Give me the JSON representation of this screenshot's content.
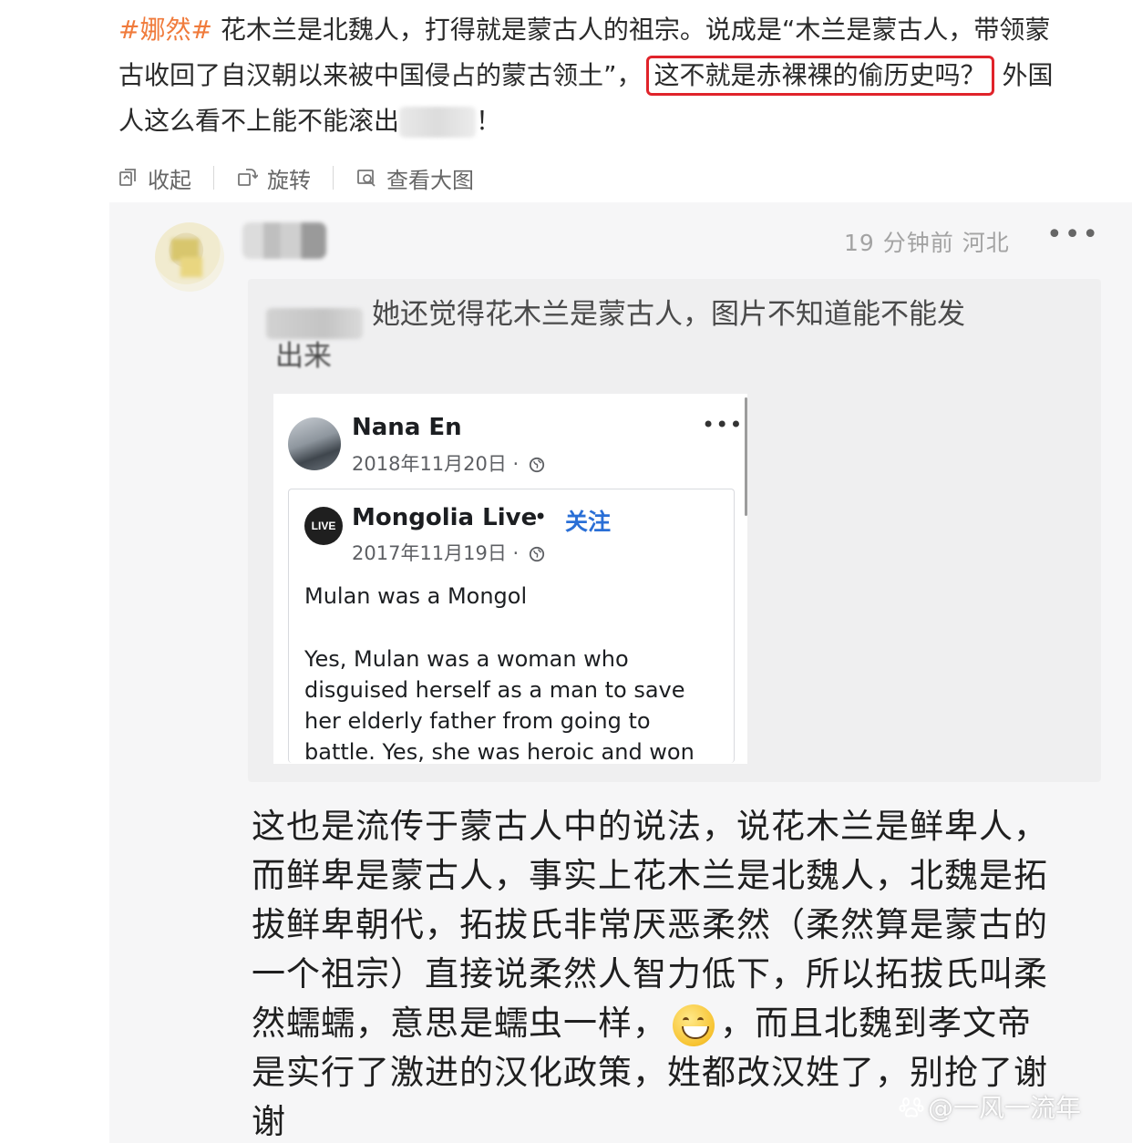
{
  "post": {
    "hashtag": "#娜然#",
    "line1_text": "花木兰是北魏人，打得就是蒙古人的祖宗。说成是“木兰是蒙古人，带领蒙",
    "line2_before": "古收回了自汉朝以来被中国侵占的蒙古领土”，",
    "line2_highlight": "这不就是赤裸裸的偷历史吗？",
    "line2_after": "外国",
    "line3_before": "人这么看不上能不能滚出",
    "line3_after": "！"
  },
  "toolbar": {
    "collapse_label": "收起",
    "rotate_label": "旋转",
    "view_large_label": "查看大图"
  },
  "comment": {
    "time_ago": "19 分钟前",
    "location": "河北",
    "more": "•••",
    "quote_line1": "她还觉得花木兰是蒙古人，图片不知道能不能发",
    "quote_line2": "出来",
    "text_lines": [
      "这也是流传于蒙古人中的说法，说花木兰是鲜卑人，",
      "而鲜卑是蒙古人，事实上花木兰是北魏人，北魏是拓",
      "拔鲜卑朝代，拓拔氏非常厌恶柔然（柔然算是蒙古的",
      "一个祖宗）直接说柔然人智力低下，所以拓拔氏叫柔"
    ],
    "line5_before": "然蠕蠕，意思是蠕虫一样，",
    "line5_after": "，而且北魏到孝文帝",
    "line6": "是实行了激进的汉化政策，姓都改汉姓了，别抢了谢",
    "line7": "谢"
  },
  "screenshot": {
    "author": "Nana En",
    "author_date": "2018年11月20日 ·",
    "more": "•••",
    "page_logo": "LIVE",
    "page_name": "Mongolia Live",
    "separator": "•",
    "follow": "关注",
    "page_date": "2017年11月19日 ·",
    "title": "Mulan was a Mongol",
    "body_lines": [
      "Yes, Mulan was a woman who",
      "disguised herself as a man to save",
      "her elderly father from going to",
      "battle. Yes, she was heroic and won"
    ]
  },
  "watermark": "@一风一流年",
  "colors": {
    "hashtag": "#f07b3c",
    "highlight_border": "#e0232a",
    "follow_link": "#2a6fd6"
  },
  "icons": [
    "collapse-icon",
    "rotate-icon",
    "view-large-icon",
    "globe-icon",
    "more-icon",
    "paw-icon",
    "grin-emoji-icon"
  ]
}
